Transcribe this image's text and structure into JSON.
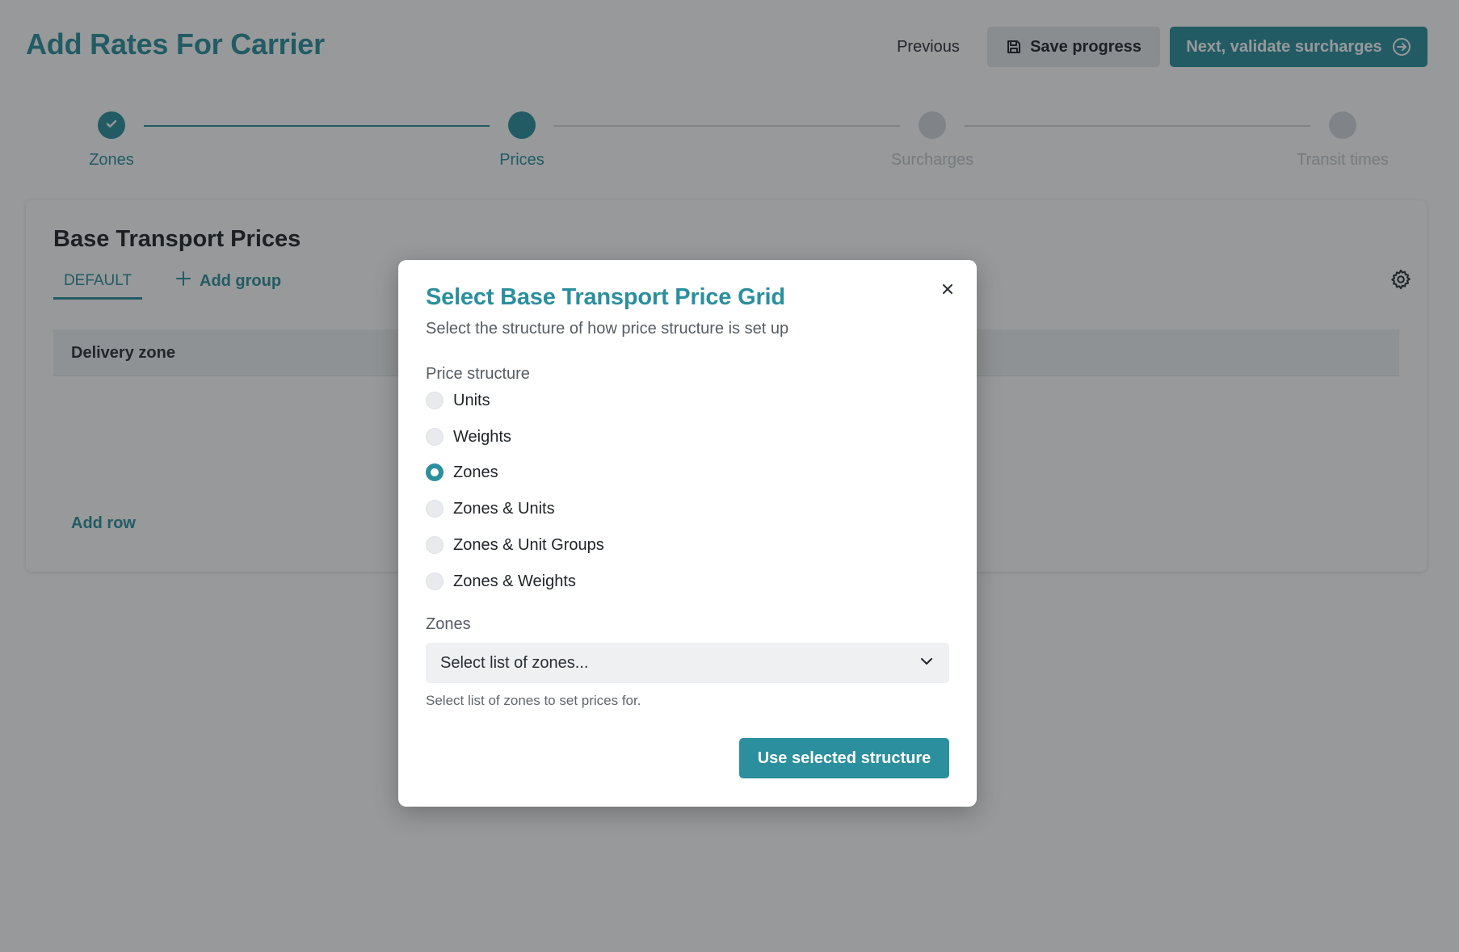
{
  "header": {
    "title": "Add Rates For Carrier",
    "previous_label": "Previous",
    "save_label": "Save progress",
    "next_label": "Next, validate surcharges"
  },
  "stepper": {
    "steps": [
      {
        "label": "Zones",
        "state": "done"
      },
      {
        "label": "Prices",
        "state": "active"
      },
      {
        "label": "Surcharges",
        "state": "todo"
      },
      {
        "label": "Transit times",
        "state": "todo"
      }
    ]
  },
  "card": {
    "title": "Base Transport Prices",
    "tabs": [
      {
        "label": "DEFAULT",
        "selected": true
      }
    ],
    "add_group_label": "Add group",
    "table": {
      "columns": [
        "Delivery zone"
      ]
    },
    "add_row_label": "Add row"
  },
  "modal": {
    "title": "Select Base Transport Price Grid",
    "subtitle": "Select the structure of how price structure is set up",
    "price_structure_label": "Price structure",
    "options": [
      {
        "label": "Units",
        "checked": false
      },
      {
        "label": "Weights",
        "checked": false
      },
      {
        "label": "Zones",
        "checked": true
      },
      {
        "label": "Zones & Units",
        "checked": false
      },
      {
        "label": "Zones & Unit Groups",
        "checked": false
      },
      {
        "label": "Zones & Weights",
        "checked": false
      }
    ],
    "zones_label": "Zones",
    "zones_placeholder": "Select list of zones...",
    "zones_hint": "Select list of zones to set prices for.",
    "submit_label": "Use selected structure"
  },
  "colors": {
    "accent": "#2b8f9d",
    "overlay": "rgba(25,28,32,0.45)",
    "step_inactive": "#d5d9de"
  },
  "icons": {
    "save": "floppy-disk-icon",
    "next": "arrow-circle-right-icon",
    "step_done": "check-icon",
    "add_group": "plus-icon",
    "settings": "gear-icon",
    "close": "close-icon",
    "select": "chevron-down-icon"
  }
}
